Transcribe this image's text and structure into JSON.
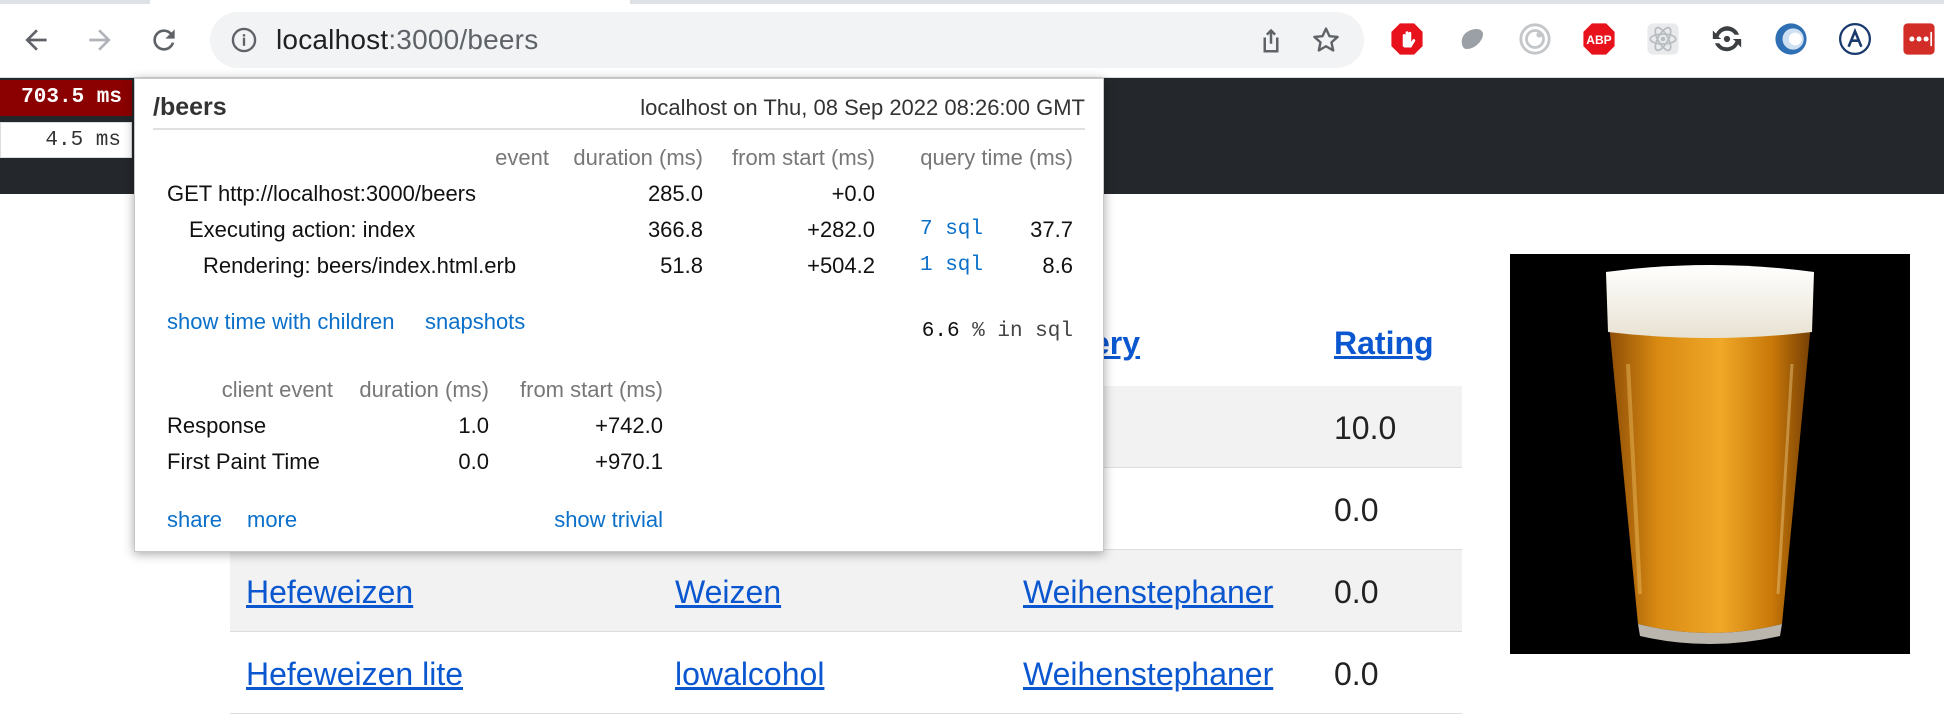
{
  "browser": {
    "url_host": "localhost",
    "url_path": ":3000/beers",
    "extensions": [
      "adblock-icon",
      "ghostery-icon",
      "privacy-badger-icon",
      "abp-icon",
      "react-devtools-icon",
      "sync-icon",
      "circle-extension-icon",
      "a-extension-icon",
      "lastpass-icon"
    ],
    "abp_label": "ABP"
  },
  "profiler": {
    "badge_main": "703.5 ms",
    "badge_sub": "4.5 ms",
    "name": "/beers",
    "machine": "localhost on Thu, 08 Sep 2022 08:26:00 GMT",
    "headers": {
      "event": "event",
      "duration": "duration (ms)",
      "from_start": "from start (ms)",
      "query_time": "query time (ms)"
    },
    "timings": [
      {
        "event": "GET http://localhost:3000/beers",
        "duration": "285.0",
        "from_start": "+0.0",
        "sql_link": "",
        "query_time": ""
      },
      {
        "event": "Executing action: index",
        "duration": "366.8",
        "from_start": "+282.0",
        "sql_link": "7 sql",
        "query_time": "37.7"
      },
      {
        "event": "Rendering: beers/index.html.erb",
        "duration": "51.8",
        "from_start": "+504.2",
        "sql_link": "1 sql",
        "query_time": "8.6"
      }
    ],
    "show_time_with_children": "show time with children",
    "snapshots": "snapshots",
    "percent_sql": "6.6",
    "percent_sql_suffix": "% in sql",
    "client_headers": {
      "event": "client event",
      "duration": "duration (ms)",
      "from_start": "from start (ms)"
    },
    "client_timings": [
      {
        "event": "Response",
        "duration": "1.0",
        "from_start": "+742.0"
      },
      {
        "event": "First Paint Time",
        "duration": "0.0",
        "from_start": "+970.1"
      }
    ],
    "share": "share",
    "more": "more",
    "show_trivial": "show trivial"
  },
  "table": {
    "brewery_header_partial": "ery",
    "rating_header": "Rating",
    "rows": [
      {
        "name": "",
        "style": "",
        "brewery": "",
        "rating": "10.0"
      },
      {
        "name": "",
        "style": "",
        "brewery": "",
        "rating": "0.0"
      },
      {
        "name": "Hefeweizen",
        "style": "Weizen",
        "brewery": "Weihenstephaner",
        "rating": "0.0"
      },
      {
        "name": "Hefeweizen lite",
        "style": "lowalcohol",
        "brewery": "Weihenstephaner",
        "rating": "0.0"
      }
    ]
  }
}
